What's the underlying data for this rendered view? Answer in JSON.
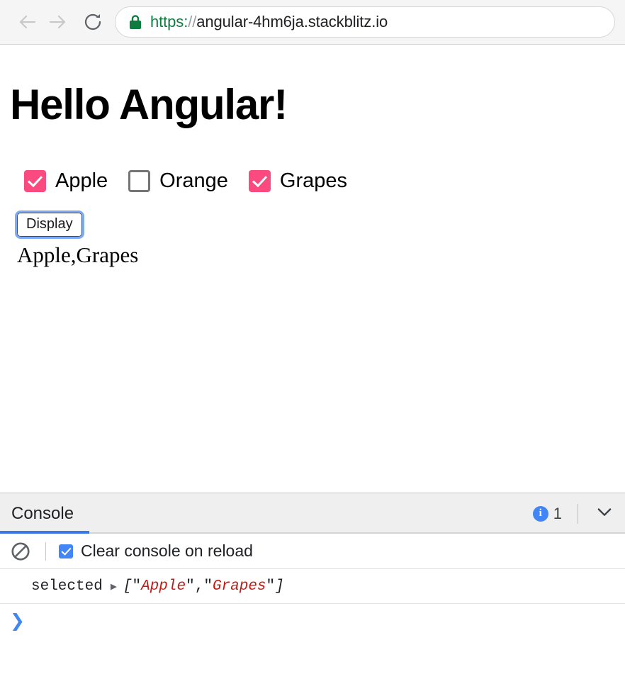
{
  "browser": {
    "back_icon": "arrow-left-icon",
    "forward_icon": "arrow-right-icon",
    "reload_icon": "reload-icon",
    "lock_icon": "lock-icon",
    "url_scheme": "https:",
    "url_slashes": "//",
    "url_host": "angular-4hm6ja.stackblitz.io",
    "url_full": "https://angular-4hm6ja.stackblitz.io"
  },
  "page": {
    "title": "Hello Angular!",
    "checkboxes": [
      {
        "label": "Apple",
        "checked": true
      },
      {
        "label": "Orange",
        "checked": false
      },
      {
        "label": "Grapes",
        "checked": true
      }
    ],
    "display_button_label": "Display",
    "selected_output": "Apple,Grapes"
  },
  "console": {
    "tab_label": "Console",
    "info_icon": "info-icon",
    "info_icon_glyph": "i",
    "info_count": "1",
    "collapse_icon": "chevron-down-icon",
    "clear_console_icon": "ban-icon",
    "clear_on_reload_label": "Clear console on reload",
    "clear_on_reload_checked": true,
    "log": {
      "name": "selected",
      "expand_arrow": "▶",
      "open_bracket": "[",
      "quote": "\"",
      "value_1": "Apple",
      "separator": ", ",
      "value_2": "Grapes",
      "close_bracket": "]"
    },
    "prompt_symbol": "❯"
  },
  "colors": {
    "checkbox_pink": "#fb4a7f",
    "checkbox_unchecked_border": "#757575",
    "focus_ring_blue": "#7baaf7",
    "tab_underline_blue": "#3b78e7",
    "console_checkbox_blue": "#4285f4",
    "url_scheme_green": "#0f7c3f",
    "log_string_red": "#c41a16"
  }
}
